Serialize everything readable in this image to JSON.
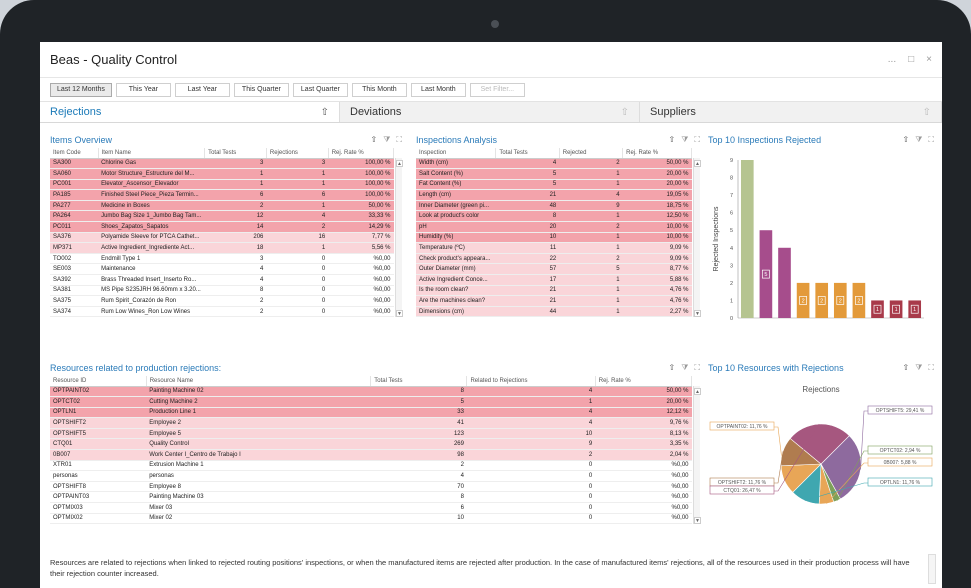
{
  "app": {
    "title": "Beas - Quality Control",
    "win_minimize": "...",
    "win_maximize": "□",
    "win_close": "×"
  },
  "filters": {
    "buttons": [
      "Last 12 Months",
      "This Year",
      "Last Year",
      "This Quarter",
      "Last Quarter",
      "This Month",
      "Last Month",
      "Set Filter..."
    ]
  },
  "tabs": [
    {
      "label": "Rejections"
    },
    {
      "label": "Deviations"
    },
    {
      "label": "Suppliers"
    }
  ],
  "icons": {
    "export": "export-icon",
    "filter": "filter-icon",
    "expand": "expand-icon",
    "glyph_export": "⇧",
    "glyph_filter": "⧩",
    "glyph_expand": "⛶"
  },
  "items_overview": {
    "title": "Items Overview",
    "columns": [
      "Item Code",
      "Item Name",
      "Total Tests",
      "Rejections",
      "Rej. Rate %"
    ],
    "rows": [
      {
        "s": "red",
        "c": [
          "SA300",
          "Chlorine Gas",
          "3",
          "3",
          "100,00 %"
        ]
      },
      {
        "s": "red",
        "c": [
          "SA060",
          "Motor Structure_Estructure del M...",
          "1",
          "1",
          "100,00 %"
        ]
      },
      {
        "s": "red",
        "c": [
          "PC001",
          "Elevator_Ascensor_Elevador",
          "1",
          "1",
          "100,00 %"
        ]
      },
      {
        "s": "red",
        "c": [
          "PA185",
          "Finished Steel Piece_Pieza Termin...",
          "6",
          "6",
          "100,00 %"
        ]
      },
      {
        "s": "red",
        "c": [
          "PA277",
          "Medicine in Boxes",
          "2",
          "1",
          "50,00 %"
        ]
      },
      {
        "s": "red",
        "c": [
          "PA264",
          "Jumbo Bag Size 1_Jumbo Bag Tam...",
          "12",
          "4",
          "33,33 %"
        ]
      },
      {
        "s": "red",
        "c": [
          "PC011",
          "Shoes_Zapatos_Sapatos",
          "14",
          "2",
          "14,29 %"
        ]
      },
      {
        "s": "pink",
        "c": [
          "SA376",
          "Polyamide Sleeve for PTCA Cathet...",
          "206",
          "16",
          "7,77 %"
        ]
      },
      {
        "s": "pink",
        "c": [
          "MP371",
          "Active Ingredient_Ingrediente Act...",
          "18",
          "1",
          "5,56 %"
        ]
      },
      {
        "s": "",
        "c": [
          "TO002",
          "Endmill Type 1",
          "3",
          "0",
          "%0,00"
        ]
      },
      {
        "s": "",
        "c": [
          "SE003",
          "Maintenance",
          "4",
          "0",
          "%0,00"
        ]
      },
      {
        "s": "",
        "c": [
          "SA392",
          "Brass Threaded Insert_Inserto Ro...",
          "4",
          "0",
          "%0,00"
        ]
      },
      {
        "s": "",
        "c": [
          "SA381",
          "MS Pipe S235JRH 96.60mm x 3.20...",
          "8",
          "0",
          "%0,00"
        ]
      },
      {
        "s": "",
        "c": [
          "SA375",
          "Rum Spirit_Corazón de Ron",
          "2",
          "0",
          "%0,00"
        ]
      },
      {
        "s": "",
        "c": [
          "SA374",
          "Rum Low Wines_Ron Low Wines",
          "2",
          "0",
          "%0,00"
        ]
      }
    ]
  },
  "inspections": {
    "title": "Inspections Analysis",
    "columns": [
      "Inspection",
      "Total Tests",
      "Rejected",
      "Rej. Rate %"
    ],
    "rows": [
      {
        "s": "red",
        "c": [
          "Width (cm)",
          "4",
          "2",
          "50,00 %"
        ]
      },
      {
        "s": "red",
        "c": [
          "Salt Content (%)",
          "5",
          "1",
          "20,00 %"
        ]
      },
      {
        "s": "red",
        "c": [
          "Fat Content (%)",
          "5",
          "1",
          "20,00 %"
        ]
      },
      {
        "s": "red",
        "c": [
          "Length (cm)",
          "21",
          "4",
          "19,05 %"
        ]
      },
      {
        "s": "red",
        "c": [
          "Inner Diameter (green pi...",
          "48",
          "9",
          "18,75 %"
        ]
      },
      {
        "s": "red",
        "c": [
          "Look at product's color",
          "8",
          "1",
          "12,50 %"
        ]
      },
      {
        "s": "red",
        "c": [
          "pH",
          "20",
          "2",
          "10,00 %"
        ]
      },
      {
        "s": "red",
        "c": [
          "Humidity (%)",
          "10",
          "1",
          "10,00 %"
        ]
      },
      {
        "s": "pink",
        "c": [
          "Temperature (ºC)",
          "11",
          "1",
          "9,09 %"
        ]
      },
      {
        "s": "pink",
        "c": [
          "Check product's appeara...",
          "22",
          "2",
          "9,09 %"
        ]
      },
      {
        "s": "pink",
        "c": [
          "Outer Diameter (mm)",
          "57",
          "5",
          "8,77 %"
        ]
      },
      {
        "s": "pink",
        "c": [
          "Active Ingredient Conce...",
          "17",
          "1",
          "5,88 %"
        ]
      },
      {
        "s": "pink",
        "c": [
          "Is the room clean?",
          "21",
          "1",
          "4,76 %"
        ]
      },
      {
        "s": "pink",
        "c": [
          "Are the machines clean?",
          "21",
          "1",
          "4,76 %"
        ]
      },
      {
        "s": "pink",
        "c": [
          "Dimensions (cm)",
          "44",
          "1",
          "2,27 %"
        ]
      }
    ]
  },
  "resources": {
    "title": "Resources related to production rejections:",
    "columns": [
      "Resource ID",
      "Resource Name",
      "Total Tests",
      "Related to Rejections",
      "Rej. Rate %"
    ],
    "rows": [
      {
        "s": "red",
        "c": [
          "OPTPAINT02",
          "Painting Machine 02",
          "8",
          "4",
          "50,00 %"
        ]
      },
      {
        "s": "red",
        "c": [
          "OPTCT02",
          "Cutting Machine 2",
          "5",
          "1",
          "20,00 %"
        ]
      },
      {
        "s": "red",
        "c": [
          "OPTLN1",
          "Production Line 1",
          "33",
          "4",
          "12,12 %"
        ]
      },
      {
        "s": "pink",
        "c": [
          "OPTSHIFT2",
          "Employee 2",
          "41",
          "4",
          "9,76 %"
        ]
      },
      {
        "s": "pink",
        "c": [
          "OPTSHIFT5",
          "Employee 5",
          "123",
          "10",
          "8,13 %"
        ]
      },
      {
        "s": "pink",
        "c": [
          "CTQ01",
          "Quality Control",
          "269",
          "9",
          "3,35 %"
        ]
      },
      {
        "s": "pink",
        "c": [
          "0B007",
          "Work Center I_Centro de Trabajo I",
          "98",
          "2",
          "2,04 %"
        ]
      },
      {
        "s": "",
        "c": [
          "XTR01",
          "Extrusion Machine 1",
          "2",
          "0",
          "%0,00"
        ]
      },
      {
        "s": "",
        "c": [
          "personas",
          "personas",
          "4",
          "0",
          "%0,00"
        ]
      },
      {
        "s": "",
        "c": [
          "OPTSHIFT8",
          "Employee 8",
          "70",
          "0",
          "%0,00"
        ]
      },
      {
        "s": "",
        "c": [
          "OPTPAINT03",
          "Painting Machine 03",
          "8",
          "0",
          "%0,00"
        ]
      },
      {
        "s": "",
        "c": [
          "OPTMIX03",
          "Mixer 03",
          "6",
          "0",
          "%0,00"
        ]
      },
      {
        "s": "",
        "c": [
          "OPTMIX02",
          "Mixer 02",
          "10",
          "0",
          "%0,00"
        ]
      }
    ]
  },
  "top10_inspections": {
    "title": "Top 10 Inspections Rejected"
  },
  "top10_resources": {
    "title": "Top 10 Resources with Rejections"
  },
  "chart_data": [
    {
      "type": "bar",
      "title": "",
      "ylabel": "Rejected Inspections",
      "ylim": [
        0,
        9
      ],
      "yticks": [
        "0",
        "1",
        "2",
        "3",
        "4",
        "5",
        "6",
        "7",
        "8",
        "9"
      ],
      "grid": false,
      "values": [
        9,
        5,
        4,
        2,
        2,
        2,
        2,
        1,
        1,
        1
      ],
      "data_labels": [
        "",
        "5",
        "",
        "2",
        "2",
        "2",
        "2",
        "1",
        "1",
        "1"
      ],
      "colors": [
        "#b5c490",
        "#a64d8c",
        "#a64d8c",
        "#e39a3a",
        "#e39a3a",
        "#e39a3a",
        "#e39a3a",
        "#a83a4a",
        "#a83a4a",
        "#a83a4a"
      ]
    },
    {
      "type": "pie",
      "title": "Rejections",
      "slices": [
        {
          "label": "OPTSHIFT5: 29,41 %",
          "value": 29.41,
          "color": "#8e6a9e",
          "side": "right"
        },
        {
          "label": "OPTCT02: 2,94 %",
          "value": 2.94,
          "color": "#7ea05a",
          "side": "right"
        },
        {
          "label": "0B007: 5,88 %",
          "value": 5.88,
          "color": "#e8a657",
          "side": "right"
        },
        {
          "label": "OPTLN1: 11,76 %",
          "value": 11.76,
          "color": "#3fa7b0",
          "side": "right"
        },
        {
          "label": "OPTPAINT02: 11,76 %",
          "value": 11.76,
          "color": "#e8a657",
          "side": "left"
        },
        {
          "label": "OPTSHIFT2: 11,76 %",
          "value": 11.76,
          "color": "#b07c4f",
          "side": "left"
        },
        {
          "label": "CTQ01: 26,47 %",
          "value": 26.47,
          "color": "#a6577f",
          "side": "left"
        }
      ]
    }
  ],
  "footer": {
    "text": "Resources are related to rejections when linked to rejected routing positions' inspections, or when the manufactured items are rejected after production. In the case of manufactured items' rejections, all of the resources used in their production process will have their rejection counter increased."
  }
}
